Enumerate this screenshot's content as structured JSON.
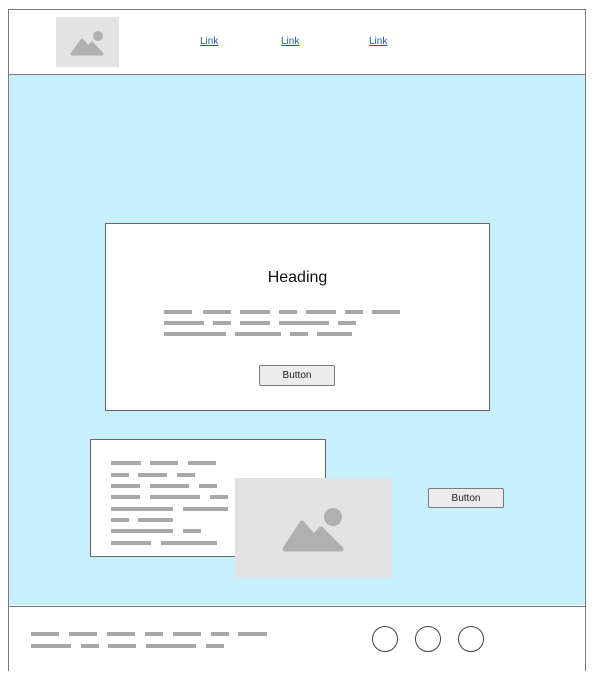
{
  "header": {
    "logo_icon": "image-placeholder-icon",
    "nav_links": [
      "Link",
      "Link",
      "Link"
    ]
  },
  "hero_card": {
    "heading": "Heading",
    "button_label": "Button"
  },
  "side_button_label": "Button",
  "content_image_icon": "image-placeholder-icon",
  "footer": {
    "social_icons": [
      "circle-icon",
      "circle-icon",
      "circle-icon"
    ]
  },
  "colors": {
    "main_background": "#c8effd",
    "placeholder": "#e3e3e3",
    "text_line": "#a8a8a8",
    "link": "#1a56c6"
  }
}
